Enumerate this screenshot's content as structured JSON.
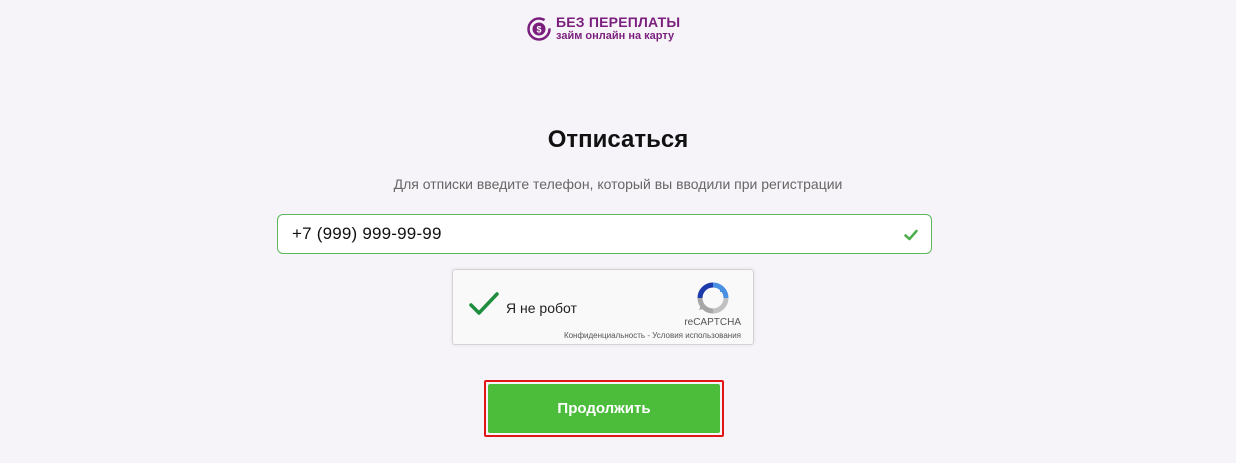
{
  "brand": {
    "name": "БЕЗ ПЕРЕПЛАТЫ",
    "tagline": "займ онлайн на карту",
    "logo_icon": "dollar-coin-icon",
    "color": "#7b1f7e"
  },
  "page": {
    "title": "Отписаться",
    "subtitle": "Для отписки введите телефон, который вы вводили при регистрации"
  },
  "phone_field": {
    "value": "+7  (999) 999-99-99",
    "status_icon": "checkmark-icon",
    "border_color": "#5cb85c"
  },
  "recaptcha": {
    "label": "Я не робот",
    "brand": "reCAPTCHA",
    "privacy_link": "Конфиденциальность",
    "separator": " - ",
    "terms_link": "Условия использования",
    "checked": true
  },
  "continue_button": {
    "label": "Продолжить",
    "color": "#4cbd3b",
    "highlight_color": "#e01515"
  }
}
